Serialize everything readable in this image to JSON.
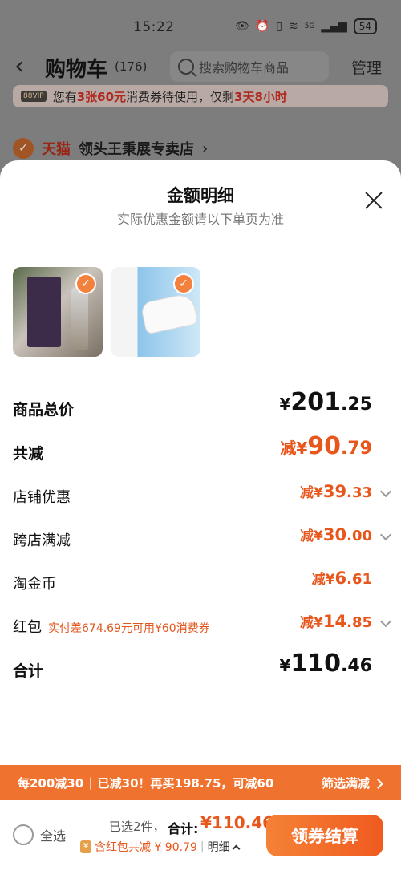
{
  "status_bar": {
    "time": "15:22",
    "battery": "54",
    "network": "5G"
  },
  "header": {
    "title": "购物车",
    "count": "(176)",
    "search_placeholder": "搜索购物车商品",
    "manage_label": "管理"
  },
  "coupon_banner": {
    "badge": "88VIP",
    "text_prefix": "您有",
    "highlight1": "3张60元",
    "text_mid": "消费券待使用，仅剩",
    "highlight2": "3天8小时"
  },
  "store": {
    "brand": "天猫",
    "name": "领头王秉展专卖店",
    "arrow": "›"
  },
  "sheet": {
    "title": "金额明细",
    "subtitle": "实际优惠金额请以下单页为准",
    "rows": [
      {
        "label": "商品总价",
        "prefix": "¥",
        "int": "201",
        "dec": ".25",
        "orange": false,
        "chevron": false,
        "note": ""
      },
      {
        "label": "共减",
        "prefix": "减¥",
        "int": "90",
        "dec": ".79",
        "orange": true,
        "chevron": false,
        "note": ""
      },
      {
        "label": "店铺优惠",
        "prefix": "减¥",
        "int": "39",
        "dec": ".33",
        "orange": true,
        "chevron": true,
        "note": ""
      },
      {
        "label": "跨店满减",
        "prefix": "减¥",
        "int": "30",
        "dec": ".00",
        "orange": true,
        "chevron": true,
        "note": ""
      },
      {
        "label": "淘金币",
        "prefix": "减¥",
        "int": "6",
        "dec": ".61",
        "orange": true,
        "chevron": false,
        "note": ""
      },
      {
        "label": "红包",
        "prefix": "减¥",
        "int": "14",
        "dec": ".85",
        "orange": true,
        "chevron": true,
        "note": "实付差674.69元可用¥60消费券"
      },
      {
        "label": "合计",
        "prefix": "¥",
        "int": "110",
        "dec": ".46",
        "orange": false,
        "chevron": false,
        "note": ""
      }
    ]
  },
  "promo": {
    "part1": "每200减30",
    "part2": "已减30！再买198.75，可减60",
    "filter_label": "筛选满减"
  },
  "footer": {
    "select_all": "全选",
    "selected": "已选2件，",
    "total_label": "合计:",
    "total_value": "¥110.46",
    "redpack_icon": "¥",
    "discount_text": "含红包共减 ¥ 90.79",
    "detail_toggle": "明细",
    "checkout_label": "领券结算"
  },
  "colors": {
    "accent": "#e8561c",
    "promo_bg": "#f0722f",
    "check": "#f2813e"
  }
}
